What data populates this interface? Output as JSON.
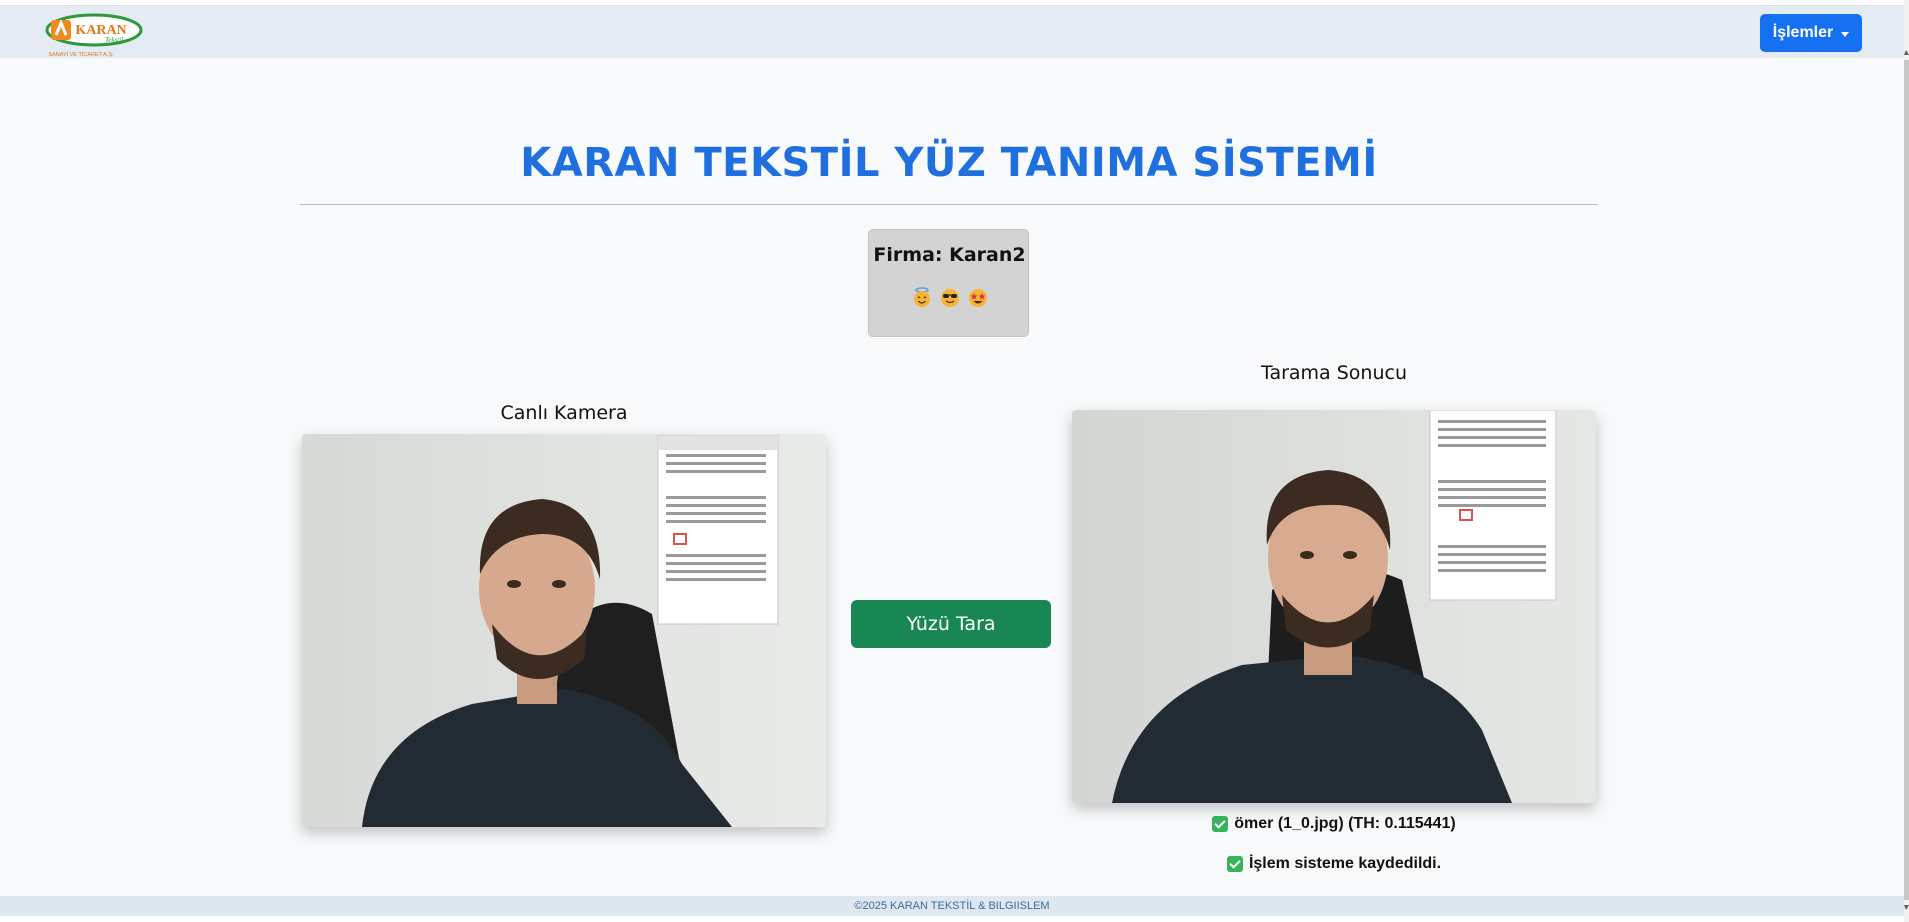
{
  "navbar": {
    "logo_icon": "karan-tekstil-logo",
    "logo_text": "KARAN",
    "logo_sub": "Tekstil",
    "logo_caption": "SANAYİ VE TİCARET A.Ş.",
    "menu_label": "İşlemler"
  },
  "main": {
    "title": "KARAN TEKSTİL YÜZ TANIMA SİSTEMİ",
    "firma": "Firma: Karan2",
    "emojis": [
      "angel-face-icon",
      "sunglasses-face-icon",
      "star-eyes-face-icon"
    ],
    "live_heading": "Canlı Kamera",
    "result_heading": "Tarama Sonucu",
    "scan_button": "Yüzü Tara",
    "result_match": "ömer (1_0.jpg) (TH: 0.115441)",
    "result_saved": "İşlem sisteme kaydedildi."
  },
  "footer": {
    "text": "©2025 KARAN TEKSTİL & BILGIISLEM"
  },
  "colors": {
    "accent": "#1f70de",
    "menu_button": "#1670f2",
    "scan_button": "#198754",
    "check": "#36b45a"
  }
}
